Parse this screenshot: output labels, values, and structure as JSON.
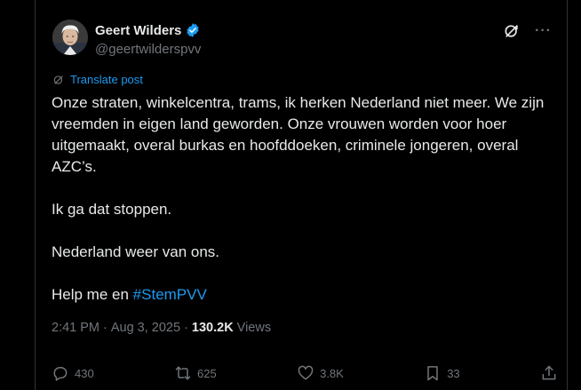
{
  "author": {
    "display_name": "Geert Wilders",
    "handle": "@geertwilderspvv"
  },
  "translate_label": "Translate post",
  "post": {
    "paragraphs": [
      "Onze straten, winkelcentra, trams, ik herken Nederland niet meer. We zijn vreemden in eigen land geworden. Onze vrouwen worden voor hoer uitgemaakt, overal burkas en hoofddoeken, criminele jongeren, overal AZC’s.",
      "Ik ga dat stoppen.",
      "Nederland weer van ons."
    ],
    "last_line_prefix": "Help me en ",
    "hashtag": "#StemPVV"
  },
  "meta": {
    "time": "2:41 PM",
    "separator1": "·",
    "date": "Aug 3, 2025",
    "separator2": "·",
    "views_count": "130.2K",
    "views_label": "Views"
  },
  "actions": {
    "replies": "430",
    "reposts": "625",
    "likes": "3.8K",
    "bookmarks": "33"
  },
  "colors": {
    "background": "#000000",
    "text": "#e7e9ea",
    "muted": "#71767b",
    "accent": "#1d9bf0",
    "verified": "#1d9bf0"
  },
  "icons": {
    "verified": "verified-badge-icon",
    "grok": "grok-icon",
    "more": "more-icon",
    "translate": "translate-icon",
    "reply": "reply-icon",
    "repost": "repost-icon",
    "like": "like-icon",
    "bookmark": "bookmark-icon",
    "share": "share-icon"
  }
}
